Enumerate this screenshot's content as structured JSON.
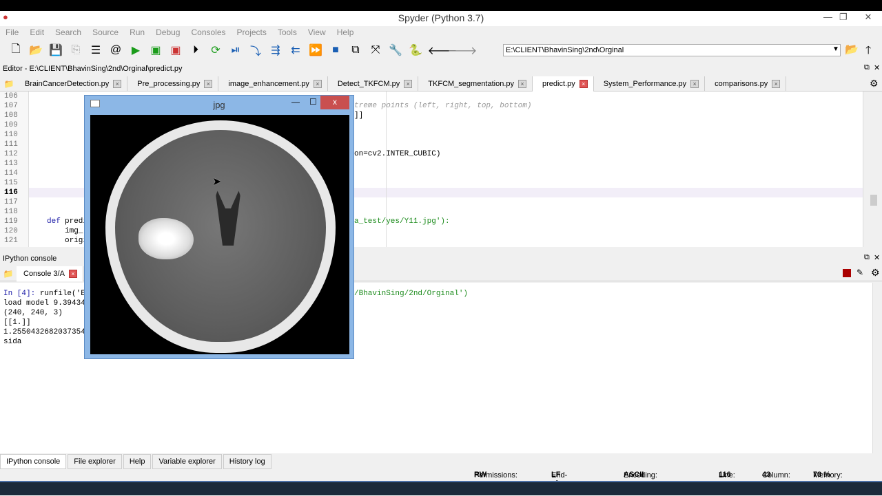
{
  "window": {
    "title": "Spyder (Python 3.7)"
  },
  "menu": [
    "File",
    "Edit",
    "Search",
    "Source",
    "Run",
    "Debug",
    "Consoles",
    "Projects",
    "Tools",
    "View",
    "Help"
  ],
  "toolbar": {
    "path": "E:\\CLIENT\\BhavinSing\\2nd\\Orginal"
  },
  "editor": {
    "header": "Editor - E:\\CLIENT\\BhavinSing\\2nd\\Orginal\\predict.py",
    "tabs": [
      "BrainCancerDetection.py",
      "Pre_processing.py",
      "image_enhancement.py",
      "Detect_TKFCM.py",
      "TKFCM_segmentation.py",
      "predict.py",
      "System_Performance.py",
      "comparisons.py"
    ],
    "active_tab": 5,
    "line_numbers": [
      "106",
      "107",
      "108",
      "109",
      "110",
      "111",
      "112",
      "113",
      "114",
      "115",
      "116",
      "117",
      "118",
      "119",
      "120",
      "121"
    ],
    "current_line": "116",
    "code": {
      "l107": "treme points (left, right, top, bottom)",
      "l108": "]]",
      "l112": "on=cv2.INTER_CUBIC)",
      "l119a": "def",
      "l119b": "predi",
      "l119c": "a_test/yes/Y11.jpg'):",
      "l120": "img_",
      "l121": "origi"
    }
  },
  "console": {
    "header": "IPython console",
    "tab": "Console 3/A",
    "lines": {
      "in_prompt": "In [4]:",
      "in_cmd": "runfile('E",
      "in_tail": "/BhavinSing/2nd/Orginal')",
      "l2": "load model 9.39434",
      "l3": "(240, 240, 3)",
      "l4": "[[1.]]",
      "l5": "1.2550432682037354",
      "l6": "sida"
    }
  },
  "image_window": {
    "title": "jpg",
    "close": "x"
  },
  "bottom_tabs": [
    "IPython console",
    "File explorer",
    "Help",
    "Variable explorer",
    "History log"
  ],
  "status": {
    "permissions_label": "Permissions:",
    "permissions": "RW",
    "eol_label": "End-of-lines:",
    "eol": "LF",
    "encoding_label": "Encoding:",
    "encoding": "ASCII",
    "line_label": "Line:",
    "line": "116",
    "column_label": "Column:",
    "column": "43",
    "memory_label": "Memory:",
    "memory": "73 %"
  }
}
